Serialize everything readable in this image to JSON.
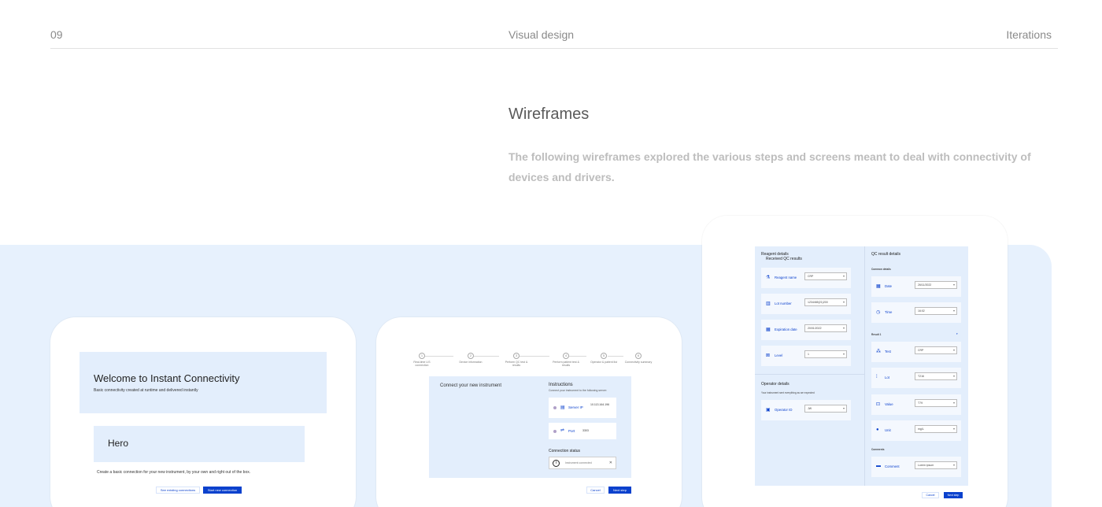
{
  "header": {
    "section_number": "09",
    "section_name": "Visual design",
    "subsection_name": "Iterations"
  },
  "content": {
    "title": "Wireframes",
    "description": "The following wireframes explored the various steps and screens meant to deal with connectivity of devices and drivers."
  },
  "wireframe_1": {
    "hero_title": "Welcome to Instant Connectivity",
    "hero_subtitle": "Basic connectivity created at runtime and delivered instantly",
    "hero2_title": "Hero",
    "body_text": "Create a basic connection for your new instrument, by your own and right out of the box.",
    "secondary_button": "See existing connections",
    "primary_button": "Start new connection"
  },
  "wireframe_2": {
    "steps": [
      {
        "num": "1",
        "label": "Real-time LIS connection"
      },
      {
        "num": "2",
        "label": "Device information"
      },
      {
        "num": "3",
        "label": "Perform QC test & results"
      },
      {
        "num": "4",
        "label": "Perform patient test & results"
      },
      {
        "num": "5",
        "label": "Operator & patient list"
      },
      {
        "num": "6",
        "label": "Connectivity summary"
      }
    ],
    "left_title": "Connect your new instrument",
    "instructions_title": "Instructions",
    "instructions_subtitle": "Connect your instrument to the following server:",
    "server_ip_label": "Server IP",
    "server_ip_value": "10.113.164.196",
    "port_label": "Port",
    "port_value": "3303",
    "status_title": "Connection status",
    "status_text": "Instrument connected",
    "cancel_button": "Cancel",
    "next_button": "Next step"
  },
  "wireframe_3": {
    "reagent_title": "Reagent details",
    "received_title": "Received QC results",
    "qc_title": "QC result details",
    "common_details": "Common details",
    "result_label": "Result 1",
    "comments_title": "Comments",
    "operator_title": "Operator details",
    "operator_subtitle": "Your instrument sent everything as we expected",
    "left_rows": [
      {
        "icon": "reagent-icon",
        "label": "Reagent name",
        "value": "CRP"
      },
      {
        "icon": "barcode-icon",
        "label": "Lot number",
        "value": "1234465(21)200"
      },
      {
        "icon": "calendar-icon",
        "label": "Expiration date",
        "value": "20/01/2022"
      },
      {
        "icon": "level-icon",
        "label": "Level",
        "value": "1"
      }
    ],
    "operator_row": {
      "icon": "id-card-icon",
      "label": "Operator ID",
      "value": "JW"
    },
    "common_rows": [
      {
        "icon": "calendar-icon",
        "label": "Date",
        "value": "26/11/2022"
      },
      {
        "icon": "clock-icon",
        "label": "Time",
        "value": "16:02"
      }
    ],
    "result_rows": [
      {
        "icon": "test-icon",
        "label": "Test",
        "value": "CRP"
      },
      {
        "icon": "lot-icon",
        "label": "Lot",
        "value": "T216"
      },
      {
        "icon": "value-icon",
        "label": "Value",
        "value": "T79"
      },
      {
        "icon": "drop-icon",
        "label": "Unit",
        "value": "mg/L"
      }
    ],
    "comment_row": {
      "icon": "comment-icon",
      "label": "Comment",
      "value": "Lorem ipsum"
    },
    "cancel_button": "Cancel",
    "next_button": "Next step"
  },
  "colors": {
    "accent": "#0b41cd",
    "band": "#e7f1fd",
    "panel": "#e3eefc"
  }
}
